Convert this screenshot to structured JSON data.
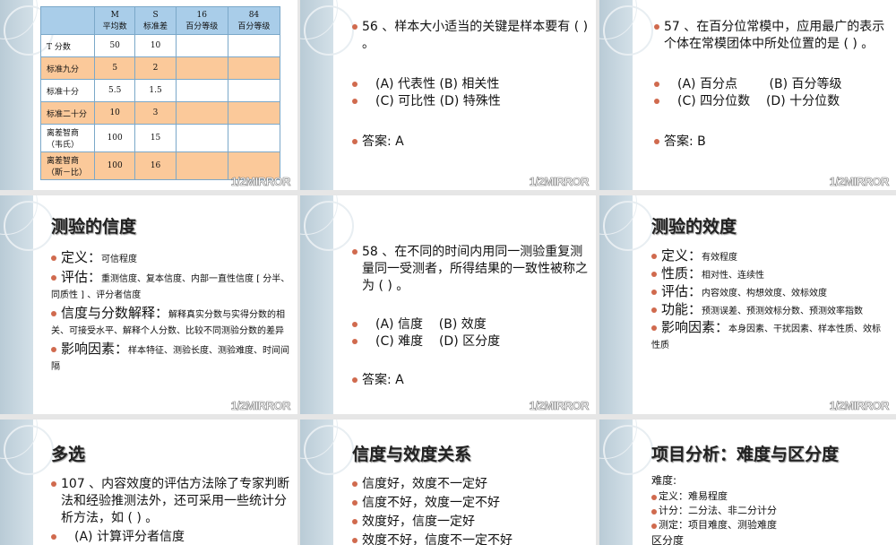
{
  "watermark": "1/2MIRROR",
  "slide1": {
    "headers": [
      "",
      "M\n平均数",
      "S\n标准差",
      "16\n百分等级",
      "84\n百分等级"
    ],
    "rows": [
      [
        "T 分数",
        "50",
        "10",
        "",
        ""
      ],
      [
        "标准九分",
        "5",
        "2",
        "",
        ""
      ],
      [
        "标准十分",
        "5.5",
        "1.5",
        "",
        ""
      ],
      [
        "标准二十分",
        "10",
        "3",
        "",
        ""
      ],
      [
        "离差智商（韦氏）",
        "100",
        "15",
        "",
        ""
      ],
      [
        "离差智商（斯－比）",
        "100",
        "16",
        "",
        ""
      ]
    ]
  },
  "slide2": {
    "question": "56 、样本大小适当的关键是样本要有 (  ) 。",
    "opt1": "(A) 代表性  (B) 相关性",
    "opt2": "(C) 可比性  (D) 特殊性",
    "answer": "答案:  A"
  },
  "slide3": {
    "question": "57 、在百分位常模中，应用最广的表示个体在常模团体中所处位置的是 (    ) 。",
    "opt1": "(A) 百分点        (B) 百分等级",
    "opt2": "(C) 四分位数    (D) 十分位数",
    "answer": "答案:  B"
  },
  "slide4": {
    "title": "测验的信度",
    "items": [
      {
        "k": "定义：",
        "v": "可信程度"
      },
      {
        "k": "评估：",
        "v": "重测信度、复本信度、内部一直性信度 [ 分半、同质性 ] 、评分者信度"
      },
      {
        "k": "信度与分数解释：",
        "v": "解释真实分数与实得分数的相关、可接受水平、解释个人分数、比较不同测验分数的差异"
      },
      {
        "k": "影响因素：",
        "v": "样本特征、测验长度、测验难度、时间间隔"
      }
    ]
  },
  "slide5": {
    "question": "58 、在不同的时间内用同一测验重复测量同一受测者，所得结果的一致性被称之为   (    ) 。",
    "opt1": "(A) 信度    (B) 效度",
    "opt2": "(C) 难度    (D) 区分度",
    "answer": "答案:  A"
  },
  "slide6": {
    "title": "测验的效度",
    "items": [
      {
        "k": "定义：",
        "v": "有效程度"
      },
      {
        "k": "性质：",
        "v": "相对性、连续性"
      },
      {
        "k": "评估：",
        "v": "内容效度、构想效度、效标效度"
      },
      {
        "k": "功能：",
        "v": "预测误差、预测效标分数、预测效率指数"
      },
      {
        "k": "影响因素：",
        "v": "本身因素、干扰因素、样本性质、效标性质"
      }
    ]
  },
  "slide7": {
    "title": "多选",
    "question": "107 、内容效度的评估方法除了专家判断法和经验推测法外，还可采用一些统计分析方法，如 (   ) 。",
    "opt1": "(A) 计算评分者信度"
  },
  "slide8": {
    "title": "信度与效度关系",
    "items": [
      "信度好，效度不一定好",
      "信度不好，效度一定不好",
      "效度好，信度一定好",
      "效度不好，信度不一定不好"
    ]
  },
  "slide9": {
    "title": "项目分析：难度与区分度",
    "subhead": "难度:",
    "items": [
      "定义：难易程度",
      "计分：二分法、非二分计分",
      "测定：项目难度、测验难度"
    ],
    "subhead2": "区分度"
  }
}
